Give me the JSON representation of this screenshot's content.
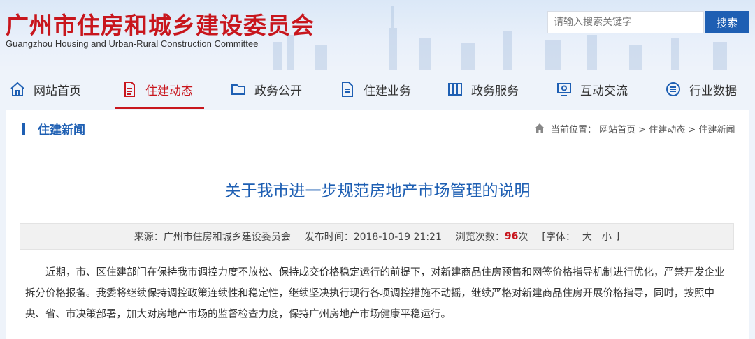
{
  "header": {
    "title": "广州市住房和城乡建设委员会",
    "subtitle": "Guangzhou Housing and Urban-Rural Construction Committee",
    "search_placeholder": "请输入搜索关键字",
    "search_button": "搜索"
  },
  "nav": {
    "items": [
      {
        "label": "网站首页",
        "icon": "home-icon",
        "active": false
      },
      {
        "label": "住建动态",
        "icon": "document-icon",
        "active": true
      },
      {
        "label": "政务公开",
        "icon": "folder-icon",
        "active": false
      },
      {
        "label": "住建业务",
        "icon": "file-list-icon",
        "active": false
      },
      {
        "label": "政务服务",
        "icon": "book-icon",
        "active": false
      },
      {
        "label": "互动交流",
        "icon": "screen-chat-icon",
        "active": false
      },
      {
        "label": "行业数据",
        "icon": "data-list-icon",
        "active": false
      }
    ]
  },
  "section": {
    "title": "住建新闻",
    "breadcrumb": "当前位置： 网站首页 > 住建动态 > 住建新闻"
  },
  "article": {
    "title": "关于我市进一步规范房地产市场管理的说明",
    "meta": {
      "source": "来源：广州市住房和城乡建设委员会",
      "published": "发布时间：2018-10-19 21:21",
      "views_label": "浏览次数：",
      "views_count": "96",
      "views_unit": "次",
      "font_label": "[字体：",
      "font_large": "大",
      "font_small": "小",
      "font_close": "]"
    },
    "body": "近期，市、区住建部门在保持我市调控力度不放松、保持成交价格稳定运行的前提下，对新建商品住房预售和网签价格指导机制进行优化，严禁开发企业拆分价格报备。我委将继续保持调控政策连续性和稳定性，继续坚决执行现行各项调控措施不动摇，继续严格对新建商品住房开展价格指导，同时，按照中央、省、市决策部署，加大对房地产市场的监督检查力度，保持广州房地产市场健康平稳运行。"
  },
  "colors": {
    "brand_red": "#c8161d",
    "link_blue": "#1e5fb3"
  }
}
